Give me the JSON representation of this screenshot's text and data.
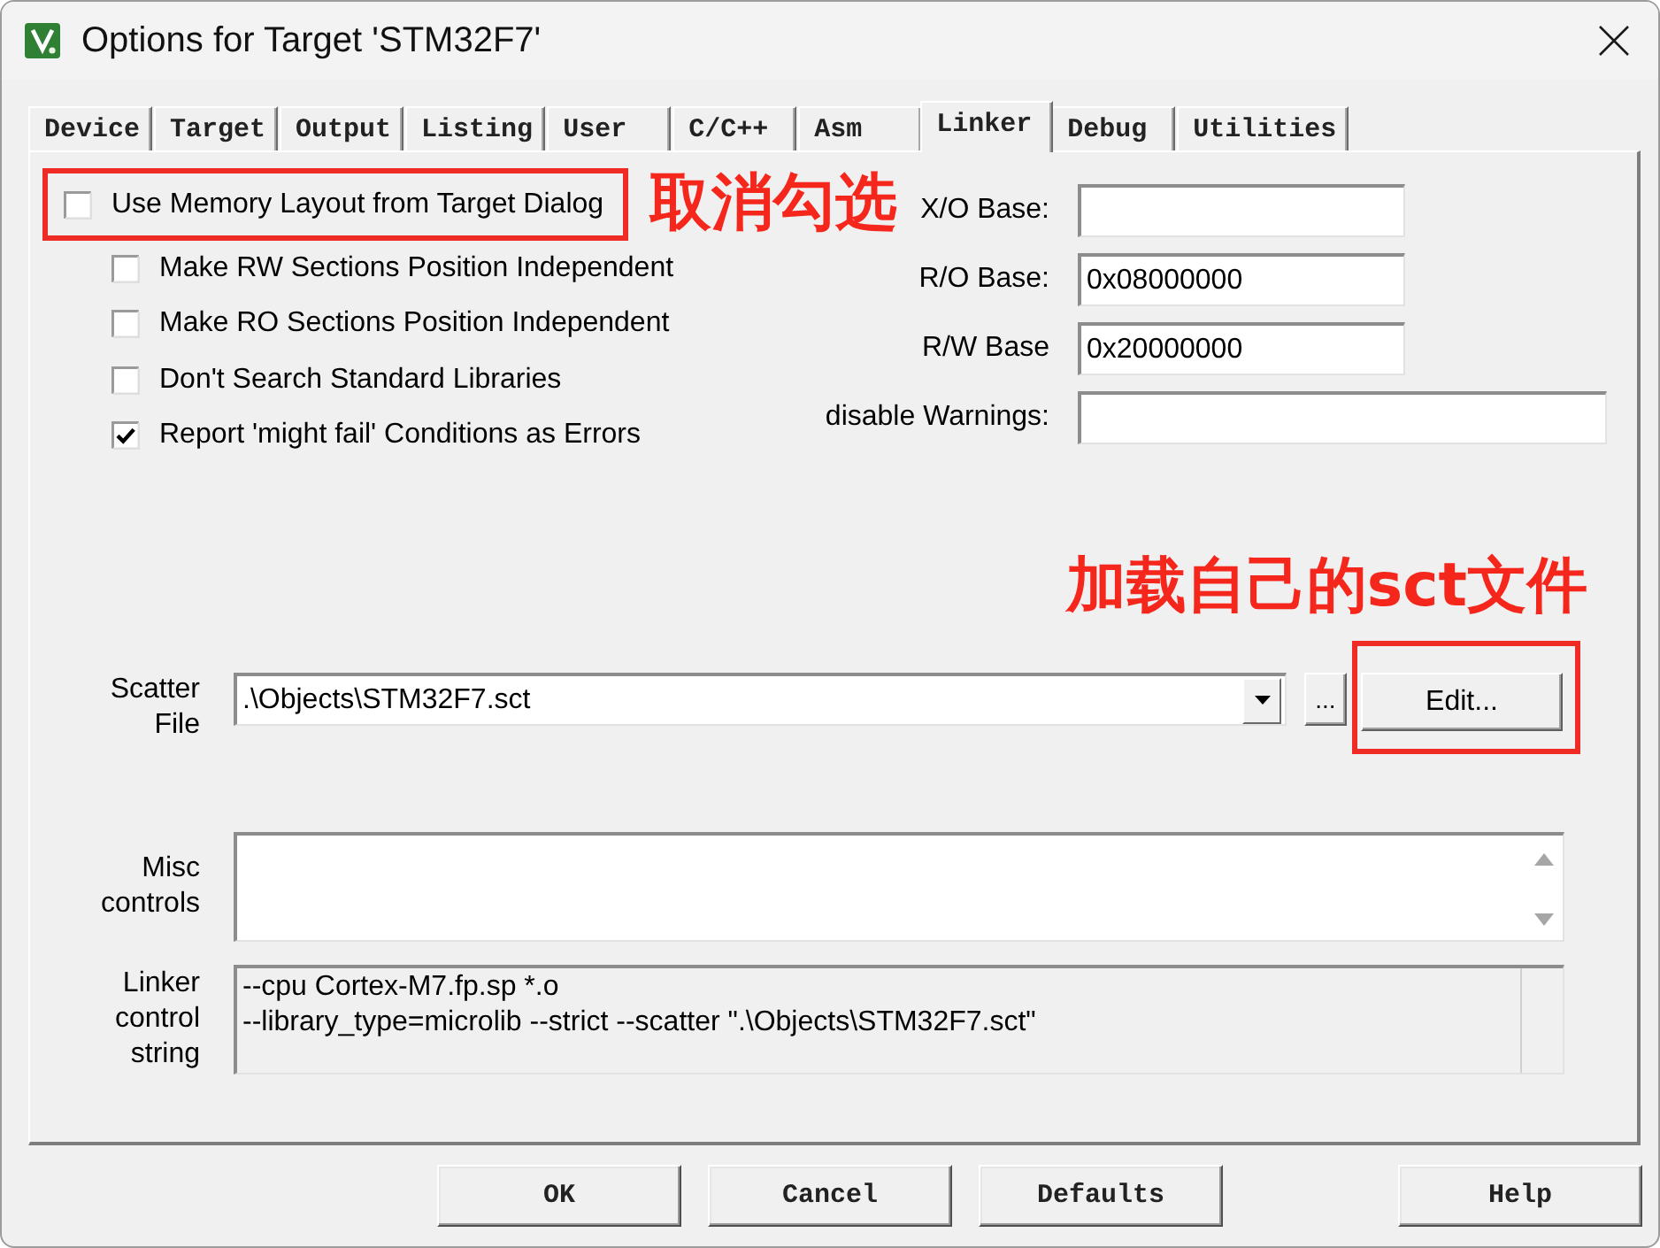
{
  "window": {
    "title": "Options for Target 'STM32F7'"
  },
  "tabs": [
    {
      "label": "Device",
      "selected": false
    },
    {
      "label": "Target",
      "selected": false
    },
    {
      "label": "Output",
      "selected": false
    },
    {
      "label": "Listing",
      "selected": false
    },
    {
      "label": "User",
      "selected": false
    },
    {
      "label": "C/C++",
      "selected": false
    },
    {
      "label": "Asm",
      "selected": false
    },
    {
      "label": "Linker",
      "selected": true
    },
    {
      "label": "Debug",
      "selected": false
    },
    {
      "label": "Utilities",
      "selected": false
    }
  ],
  "memory_layout": {
    "label": "Use Memory Layout from Target Dialog",
    "checked": false,
    "highlighted": true,
    "annotation": "取消勾选"
  },
  "options": [
    {
      "label": "Make RW Sections Position Independent",
      "checked": false
    },
    {
      "label": "Make RO Sections Position Independent",
      "checked": false
    },
    {
      "label": "Don't Search Standard Libraries",
      "checked": false
    },
    {
      "label": "Report 'might fail' Conditions as Errors",
      "checked": true
    }
  ],
  "address_fields": [
    {
      "label": "X/O Base:"
    },
    {
      "label": "R/O Base:",
      "value": "0x08000000"
    },
    {
      "label": "R/W Base",
      "value": "0x20000000"
    }
  ],
  "warnings_field": {
    "label": "disable Warnings:"
  },
  "scatter_file": {
    "label": "Scatter File",
    "value": ".\\Objects\\STM32F7.sct",
    "browse_button": "...",
    "edit_button": {
      "label": "Edit...",
      "highlighted": true,
      "annotation": "加载自己的sct文件"
    }
  },
  "misc_controls": {
    "label": "Misc controls"
  },
  "linker_control_string": {
    "label": "Linker control string",
    "lines": [
      "--cpu Cortex-M7.fp.sp *.o",
      "--library_type=microlib --strict --scatter \".\\Objects\\STM32F7.sct\""
    ]
  },
  "buttons": [
    {
      "label": "OK"
    },
    {
      "label": "Cancel"
    },
    {
      "label": "Defaults"
    },
    {
      "label": "Help"
    }
  ]
}
